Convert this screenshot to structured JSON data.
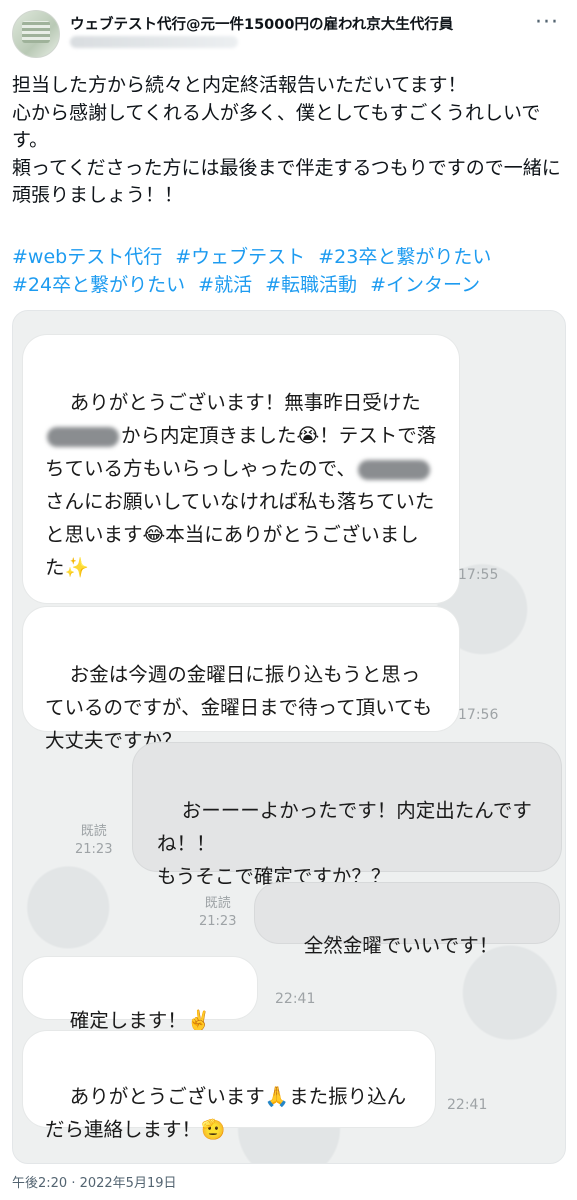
{
  "author": {
    "name": "ウェブテスト代行@元一件15000円の雇われ京大生代行員",
    "more_icon": "more-horizontal-icon"
  },
  "tweet": {
    "text": "担当した方から続々と内定終活報告いただいてます！\n心から感謝してくれる人が多く、僕としてもすごくうれしいです。\n頼ってくださった方には最後まで伴走するつもりですので一緒に頑張りましょう！！",
    "hashtags": [
      "#webテスト代行",
      "#ウェブテスト",
      "#23卒と繋がりたい",
      "#24卒と繋がりたい",
      "#就活",
      "#転職活動",
      "#インターン"
    ],
    "timestamp": "午後2:20 · 2022年5月19日"
  },
  "chat": {
    "messages": [
      {
        "side": "left",
        "text_a": "ありがとうございます！無事昨日受けた",
        "text_b": "から内定頂きました😭！テストで落ちている方もいらっしゃったので、",
        "text_c": "さんにお願いしていなければ私も落ちていたと思います😂本当にありがとうございました✨",
        "time": "17:55"
      },
      {
        "side": "left",
        "text": "お金は今週の金曜日に振り込もうと思っているのですが、金曜日まで待って頂いても大丈夫ですか？",
        "time": "17:56"
      },
      {
        "side": "right",
        "text": "おーーーよかったです！内定出たんですね！！\nもうそこで確定ですか？？",
        "read": "既読",
        "time": "21:23"
      },
      {
        "side": "right",
        "text": "全然金曜でいいです！",
        "read": "既読",
        "time": "21:23"
      },
      {
        "side": "left",
        "text": "確定します！✌️",
        "time": "22:41"
      },
      {
        "side": "left",
        "text": "ありがとうございます🙏また振り込んだら連絡します！🫡",
        "time": "22:41"
      }
    ]
  },
  "colors": {
    "hashtag": "#1d9bf0",
    "text": "#0f1419",
    "muted": "#536471"
  }
}
